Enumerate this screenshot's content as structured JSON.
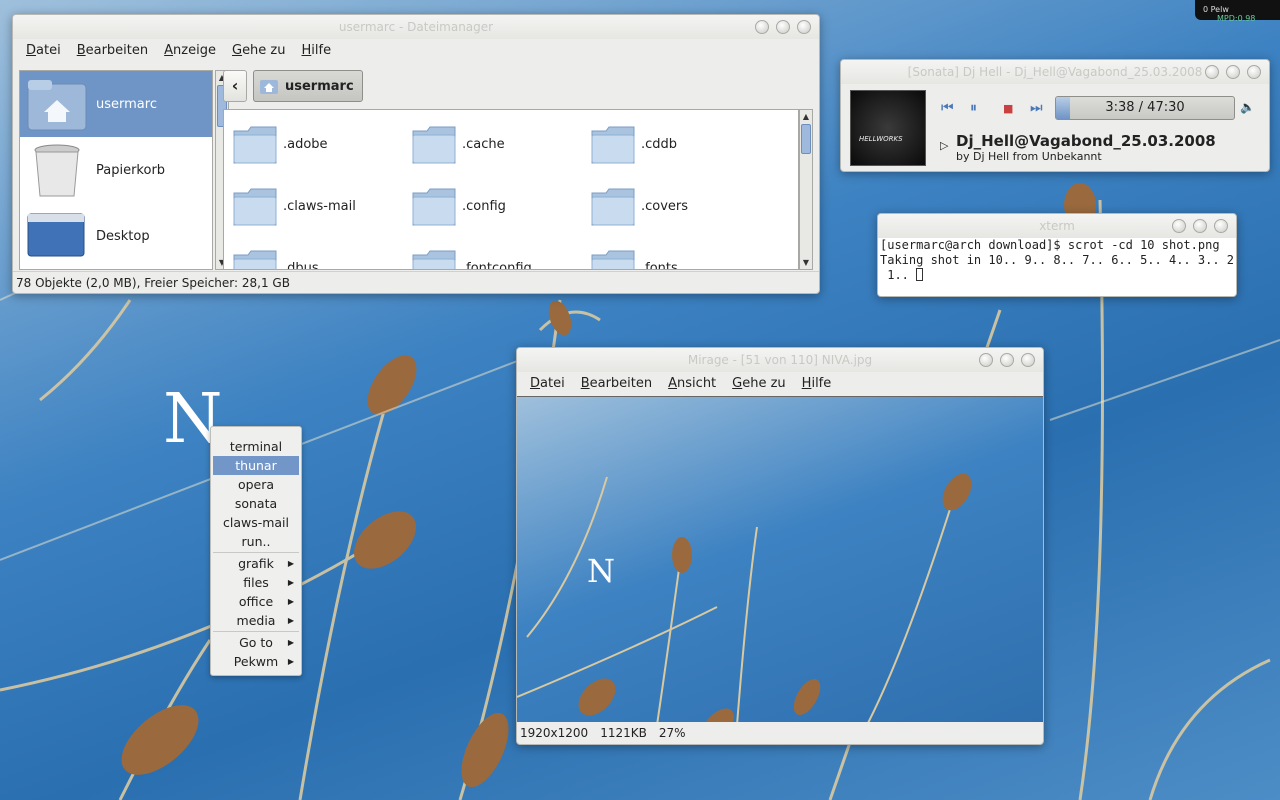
{
  "desktop": {
    "logo_letter": "N",
    "top_widget": {
      "left": "0 Pelw",
      "right": "MPD:0.98"
    }
  },
  "thunar": {
    "title": "usermarc - Dateimanager",
    "menu": [
      {
        "hot": "D",
        "rest": "atei"
      },
      {
        "hot": "B",
        "rest": "earbeiten"
      },
      {
        "hot": "A",
        "rest": "nzeige"
      },
      {
        "hot": "G",
        "rest": "ehe zu"
      },
      {
        "hot": "H",
        "rest": "ilfe"
      }
    ],
    "sidebar": [
      "usermarc",
      "Papierkorb",
      "Desktop"
    ],
    "path": "usermarc",
    "files": [
      ".adobe",
      ".cache",
      ".cddb",
      ".claws-mail",
      ".config",
      ".covers",
      ".dbus",
      ".fontconfig",
      ".fonts"
    ],
    "status": "78 Objekte (2,0 MB), Freier Speicher: 28,1 GB"
  },
  "sonata": {
    "title": "[Sonata] Dj Hell - Dj_Hell@Vagabond_25.03.2008",
    "time": "3:38 / 47:30",
    "progress_fraction": 0.076,
    "song_title": "Dj_Hell@Vagabond_25.03.2008",
    "song_sub": "by Dj Hell from Unbekannt",
    "cover_text": "HELLWORKS"
  },
  "xterm": {
    "title": "xterm",
    "lines": [
      "[usermarc@arch download]$ scrot -cd 10 shot.png",
      "Taking shot in 10.. 9.. 8.. 7.. 6.. 5.. 4.. 3.. 2..",
      " 1.. "
    ]
  },
  "mirage": {
    "title": "Mirage - [51 von 110] NIVA.jpg",
    "menu": [
      {
        "hot": "D",
        "rest": "atei"
      },
      {
        "hot": "B",
        "rest": "earbeiten"
      },
      {
        "hot": "A",
        "rest": "nsicht"
      },
      {
        "hot": "G",
        "rest": "ehe zu"
      },
      {
        "hot": "H",
        "rest": "ilfe"
      }
    ],
    "status": {
      "resolution": "1920x1200",
      "size": "1121KB",
      "zoom": "27%"
    }
  },
  "root_menu": {
    "items": [
      "terminal",
      "thunar",
      "opera",
      "sonata",
      "claws-mail",
      "run.."
    ],
    "submenus": [
      "grafik",
      "files",
      "office",
      "media"
    ],
    "wm": [
      "Go to",
      "Pekwm"
    ],
    "selected": "thunar"
  },
  "colors": {
    "selection": "#7296c8",
    "sky": "#3d82c2"
  }
}
